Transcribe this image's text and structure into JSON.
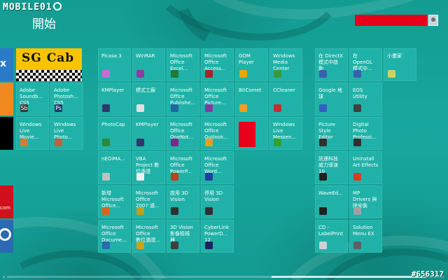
{
  "watermark": "MOBILE01",
  "header": {
    "title": "開始"
  },
  "edge": {
    "tile1_text": "x",
    "tile5_text": "com"
  },
  "sgcab": {
    "text": "SG Cab"
  },
  "tiles": [
    {
      "label": "Picasa 3",
      "icon": "picasa-icon",
      "color": "#c56bd8"
    },
    {
      "label": "WinRAR",
      "icon": "winrar-icon",
      "color": "#8a3fa0"
    },
    {
      "label": "Microsoft\nOffice\nExcel...",
      "icon": "excel-icon",
      "color": "#1f7a3a"
    },
    {
      "label": "Microsoft\nOffice\nAccess...",
      "icon": "access-icon",
      "color": "#a4262c"
    },
    {
      "label": "GOM\nPlayer",
      "icon": "gom-icon",
      "color": "#f0a500"
    },
    {
      "label": "Windows\nMedia\nCenter",
      "icon": "media-center-icon",
      "color": "#3a9a3a"
    },
    {
      "label": "在 DirectX\n模式中啟\n動",
      "icon": "directx-icon",
      "color": "#3a5fb0"
    },
    {
      "label": "在\nOpenGL\n模式中...",
      "icon": "opengl-icon",
      "color": "#3a5fb0"
    },
    {
      "label": "小畫家",
      "icon": "paint-icon",
      "color": "#d0d060"
    },
    {
      "label": "KMPlayer",
      "icon": "kmplayer-icon",
      "color": "#2a3a6a"
    },
    {
      "label": "標式工廠",
      "icon": "factory-icon",
      "color": "#e0e0e0"
    },
    {
      "label": "Microsoft\nOffice\nPublishe...",
      "icon": "publisher-icon",
      "color": "#1a6aa0"
    },
    {
      "label": "Microsoft\nOffice\nPicture...",
      "icon": "picture-icon",
      "color": "#7a3fa0"
    },
    {
      "label": "BitComet",
      "icon": "bitcomet-icon",
      "color": "#f0a020"
    },
    {
      "label": "CCleaner",
      "icon": "ccleaner-icon",
      "color": "#c03030"
    },
    {
      "label": "Google 地\n球",
      "icon": "google-earth-icon",
      "color": "#3060c0"
    },
    {
      "label": "EOS\nUtility",
      "icon": "eos-icon",
      "color": "#404040"
    },
    {
      "label": "PhotoCap",
      "icon": "photocap-icon",
      "color": "#2a8a3a"
    },
    {
      "label": "KMPlayer",
      "icon": "kmplayer-icon",
      "color": "#2a3a6a"
    },
    {
      "label": "Microsoft\nOffice\nOneNot...",
      "icon": "onenote-icon",
      "color": "#7a2a8a"
    },
    {
      "label": "Microsoft\nOffice\nOutlook...",
      "icon": "outlook-icon",
      "color": "#e0a020"
    },
    {
      "label": "",
      "icon": "redacted-icon",
      "color": "#e8001a"
    },
    {
      "label": "Windows\nLive\nMessen...",
      "icon": "messenger-icon",
      "color": "#30a030"
    },
    {
      "label": "Picture\nStyle\nEditor",
      "icon": "picture-style-icon",
      "color": "#303030"
    },
    {
      "label": "Digital\nPhoto\nProfessi...",
      "icon": "dpp-icon",
      "color": "#303030"
    },
    {
      "label": "nEOiMA...",
      "icon": "neoimaging-icon",
      "color": "#c0c0c0"
    },
    {
      "label": "VBA\nProject 數\n位憑證",
      "icon": "vba-icon",
      "color": "#f0f0f0"
    },
    {
      "label": "Microsoft\nOffice\nPowerP...",
      "icon": "powerpoint-icon",
      "color": "#c04020"
    },
    {
      "label": "Microsoft\nOffice\nWord...",
      "icon": "word-icon",
      "color": "#2040a0"
    },
    {
      "label": "訊連科技\n威力導演\n10",
      "icon": "powerdirector-icon",
      "color": "#202020"
    },
    {
      "label": "Uninstall\nArt Effects",
      "icon": "uninstall-icon",
      "color": "#d04020"
    },
    {
      "label": "新增\nMicrosoft\nOffice...",
      "icon": "office-new-icon",
      "color": "#e06020"
    },
    {
      "label": "Microsoft\nOffice\n2007 語...",
      "icon": "office-lang-icon",
      "color": "#c0a020"
    },
    {
      "label": "啟用 3D\nVision",
      "icon": "3dvision-icon",
      "color": "#303030"
    },
    {
      "label": "停用 3D\nVision",
      "icon": "3dvision-off-icon",
      "color": "#303030"
    },
    {
      "label": "WaveEd...",
      "icon": "waveeditor-icon",
      "color": "#202020"
    },
    {
      "label": "MP\nDrivers 與\n除安裝",
      "icon": "mp-drivers-icon",
      "color": "#a0a0a0"
    },
    {
      "label": "Microsoft\nOffice\nDocume...",
      "icon": "document-icon",
      "color": "#2a6ab0"
    },
    {
      "label": "Microsoft\nOffice\n數位憑證...",
      "icon": "certificate-icon",
      "color": "#d0a020"
    },
    {
      "label": "3D Vision\n影像檢視\n器",
      "icon": "3dviewer-icon",
      "color": "#404040"
    },
    {
      "label": "CyberLink\nPowerD...\n12",
      "icon": "cyberlink-icon",
      "color": "#202060"
    },
    {
      "label": "CD -\nLabelPrint",
      "icon": "labelprint-icon",
      "color": "#d0d0d0"
    },
    {
      "label": "Solution\nMenu EX",
      "icon": "solution-menu-icon",
      "color": "#606060"
    }
  ],
  "left_tiles": [
    {
      "label": "Adobe\nSoundb...\nCS5",
      "icon_text": "Sb",
      "color": "#3a3a3a"
    },
    {
      "label": "Adobe\nPhotosh...\nCS5",
      "icon_text": "Ps",
      "color": "#1a3a6a"
    },
    {
      "label": "Windows\nLive\nMovie...",
      "icon_text": "",
      "color": "#d08030"
    },
    {
      "label": "Windows\nLive\nPhoto...",
      "icon_text": "",
      "color": "#c06040"
    }
  ],
  "footer": {
    "scroll_left": "‹",
    "photo_id": "#656317"
  }
}
